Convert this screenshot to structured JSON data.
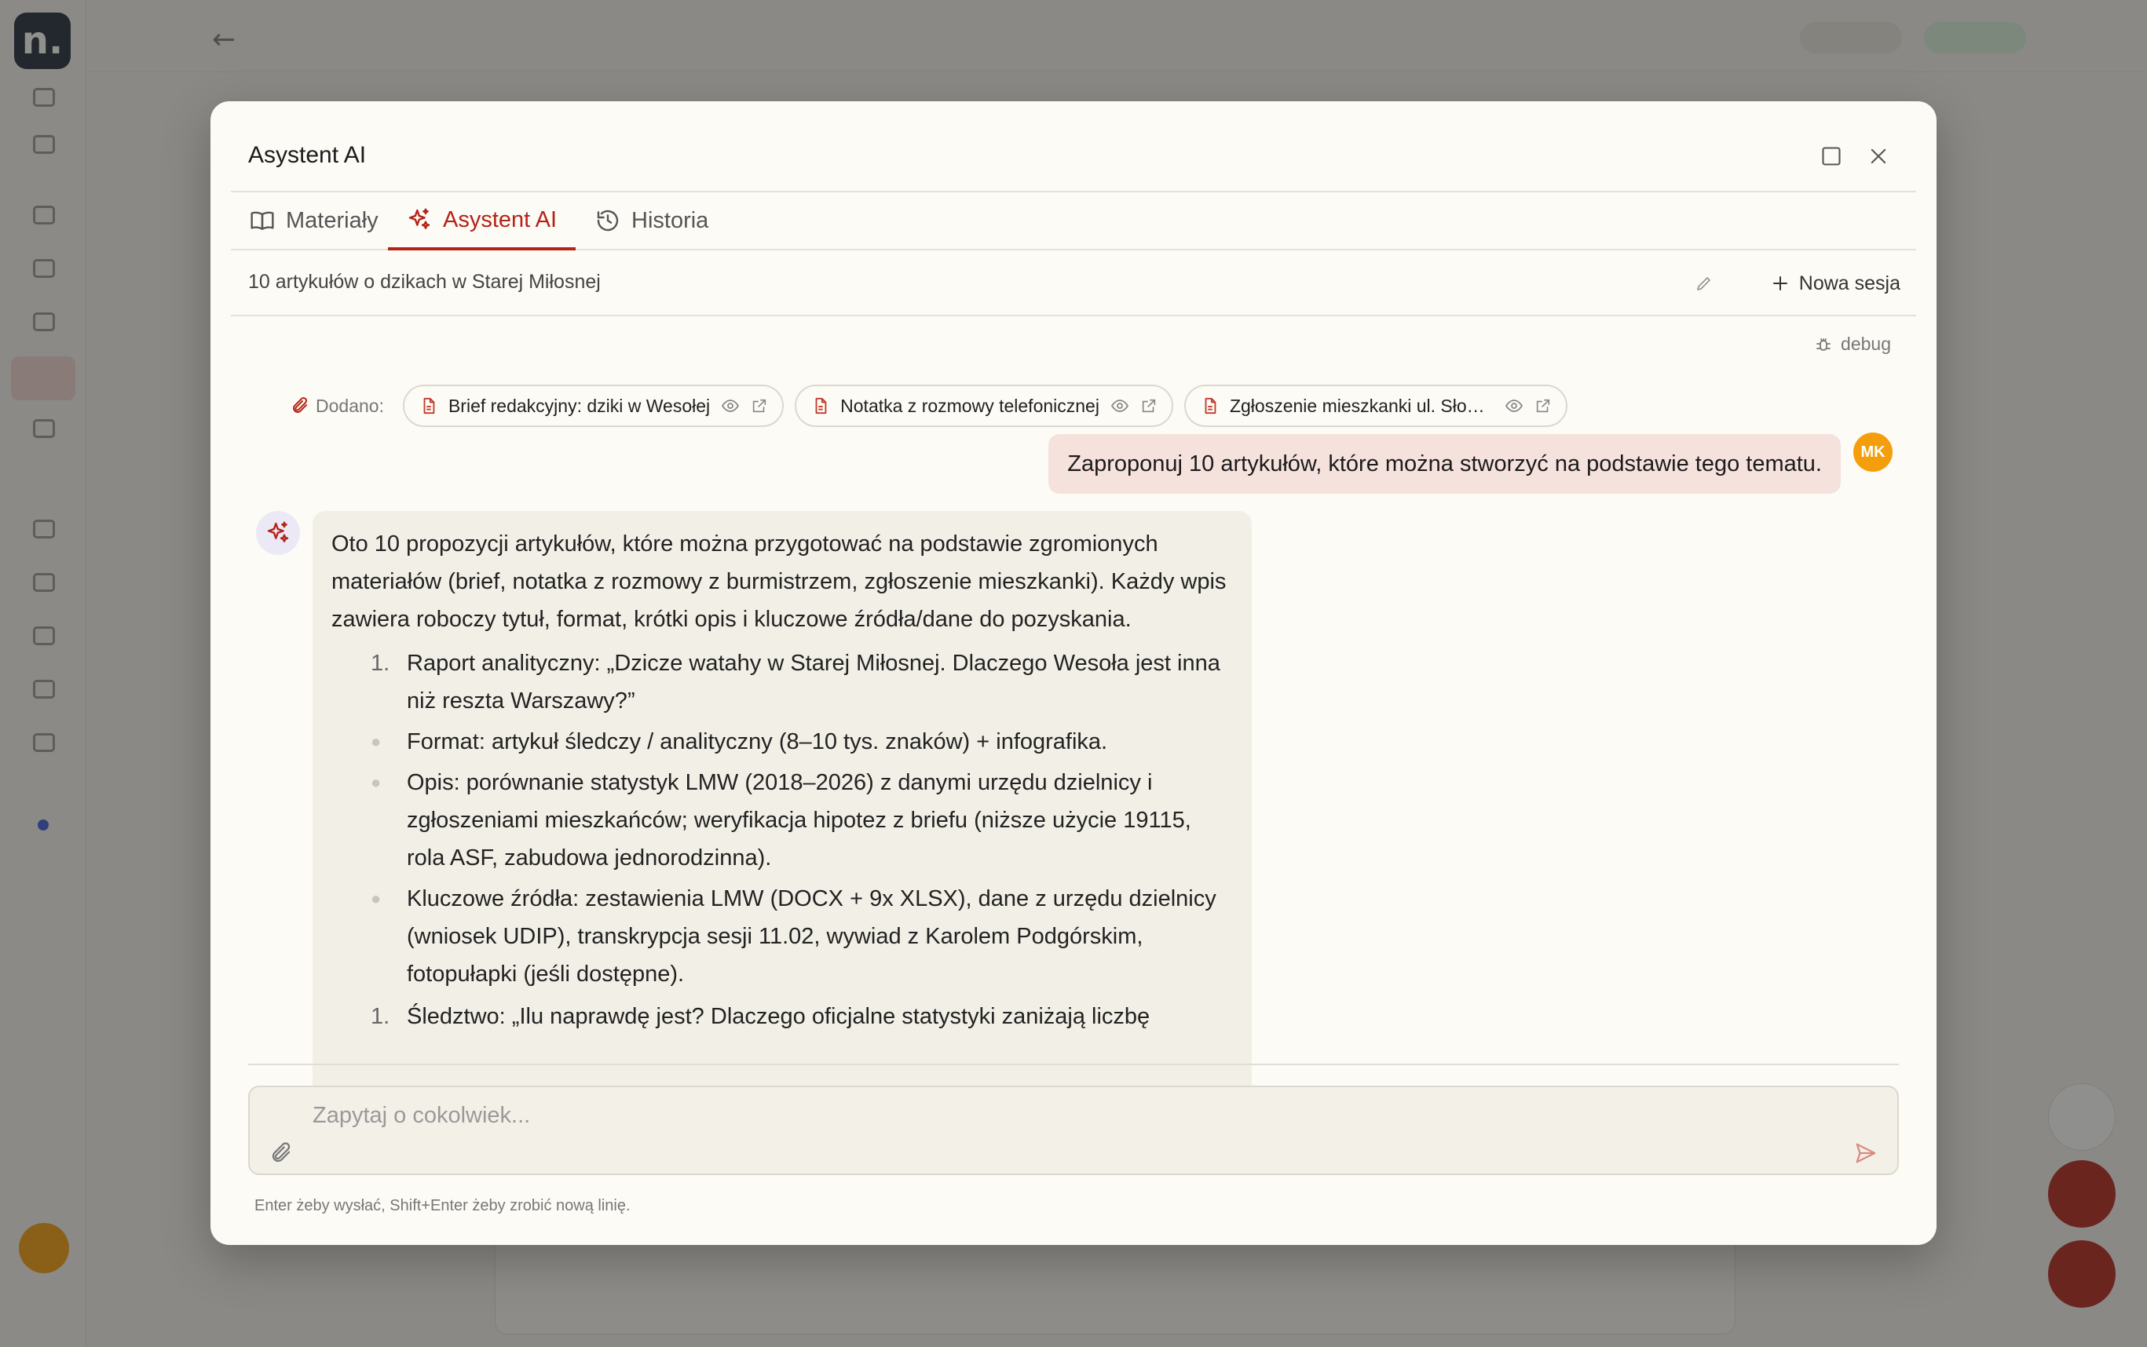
{
  "background": {
    "logo_letter": "n."
  },
  "modal": {
    "title": "Asystent AI"
  },
  "tabs": [
    {
      "label": "Materiały",
      "icon": "book-open-icon"
    },
    {
      "label": "Asystent AI",
      "icon": "sparkles-icon",
      "active": true
    },
    {
      "label": "Historia",
      "icon": "history-icon"
    }
  ],
  "session": {
    "title": "10 artykułów o dzikach w Starej Miłosnej",
    "new_session_label": "Nowa sesja"
  },
  "debug_label": "debug",
  "attachments": {
    "label": "Dodano:",
    "items": [
      {
        "name": "Brief redakcyjny: dziki w Wesołej"
      },
      {
        "name": "Notatka z rozmowy telefonicznej"
      },
      {
        "name": "Zgłoszenie mieszkanki ul. Słonecznej"
      }
    ]
  },
  "user_message": {
    "avatar_initials": "MK",
    "text": "Zaproponuj 10 artykułów, które można stworzyć na podstawie tego tematu."
  },
  "ai_message": {
    "intro": "Oto 10 propozycji artykułów, które można przygotować na podstawie zgromionych materiałów (brief, notatka z rozmowy z burmistrzem, zgłoszenie mieszkanki). Każdy wpis zawiera roboczy tytuł, format, krótki opis i kluczowe źródła/dane do pozyskania.",
    "items": [
      {
        "number": "1.",
        "title": "Raport analityczny: „Dzicze watahy w Starej Miłosnej. Dlaczego Wesoła jest inna niż reszta Warszawy?”",
        "bullets": [
          "Format: artykuł śledczy / analityczny (8–10 tys. znaków) + infografika.",
          "Opis: porównanie statystyk LMW (2018–2026) z danymi urzędu dzielnicy i zgłoszeniami mieszkańców; weryfikacja hipotez z briefu (niższe użycie 19115, rola ASF, zabudowa jednorodzinna).",
          "Kluczowe źródła: zestawienia LMW (DOCX + 9x XLSX), dane z urzędu dzielnicy (wniosek UDIP), transkrypcja sesji 11.02, wywiad z Karolem Podgórskim, fotopułapki (jeśli dostępne)."
        ]
      },
      {
        "number": "1.",
        "title": "Śledztwo: „Ilu naprawdę jest? Dlaczego oficjalne statystyki zaniżają liczbę",
        "bullets": []
      }
    ]
  },
  "composer": {
    "placeholder": "Zapytaj o cokolwiek...",
    "hint": "Enter żeby wysłać, Shift+Enter żeby zrobić nową linię."
  },
  "colors": {
    "accent": "#b42318",
    "user_bubble": "#f6e2dd",
    "ai_bubble": "#f2efe6",
    "avatar": "#f59e0b"
  }
}
